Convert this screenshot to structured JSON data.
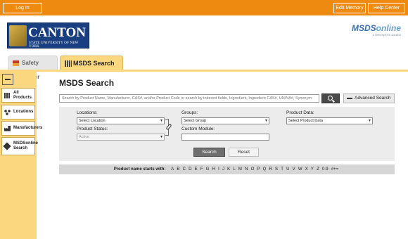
{
  "topbar": {
    "login_label": "Log In",
    "edit_memory_label": "Edit Memory",
    "help_center_label": "Help Center"
  },
  "branding": {
    "school_name": "CANTON",
    "school_sub": "STATE UNIVERSITY OF NEW YORK",
    "msds_logo_main": "MSDS",
    "msds_logo_online": "online",
    "msds_logo_tag": "a VelocityEHS solution"
  },
  "tabs": [
    {
      "label": "Safety Center",
      "icon": "flag-icon"
    },
    {
      "label": "MSDS Search",
      "icon": "binders-icon"
    }
  ],
  "sidebar": {
    "items": [
      {
        "label": "All Products",
        "icon": "binders-icon"
      },
      {
        "label": "Locations",
        "icon": "locations-icon"
      },
      {
        "label": "Manufacturers",
        "icon": "factory-icon"
      },
      {
        "label": "MSDSonline Search",
        "icon": "diamond-icon"
      }
    ]
  },
  "main": {
    "title": "MSDS Search",
    "search_placeholder": "Search by Product Name, Manufacturer, CAS#, and/or Product Code or search by indexed fields, Ingredient, Ingredient CAS#, UN/NA#, Synonym",
    "advanced_search_label": "Advanced Search"
  },
  "filters": {
    "locations_label": "Locations:",
    "locations_value": "Select Location",
    "product_status_label": "Product Status:",
    "product_status_value": "Active",
    "groups_label": "Groups:",
    "groups_value": "Select Group",
    "custom_module_label": "Custom Module:",
    "product_data_label": "Product Data:",
    "product_data_value": "Select Product Data",
    "search_label": "Search",
    "reset_label": "Reset"
  },
  "alphabet": {
    "label": "Product name starts with:",
    "letters": [
      "A",
      "B",
      "C",
      "D",
      "E",
      "F",
      "G",
      "H",
      "I",
      "J",
      "K",
      "L",
      "M",
      "N",
      "O",
      "P",
      "Q",
      "R",
      "S",
      "T",
      "U",
      "V",
      "W",
      "X",
      "Y",
      "Z",
      "0-9",
      "#+="
    ]
  },
  "colors": {
    "brand_orange": "#ef8a10",
    "tab_yellow": "#fbd77f",
    "canton_blue": "#1a3f80"
  }
}
